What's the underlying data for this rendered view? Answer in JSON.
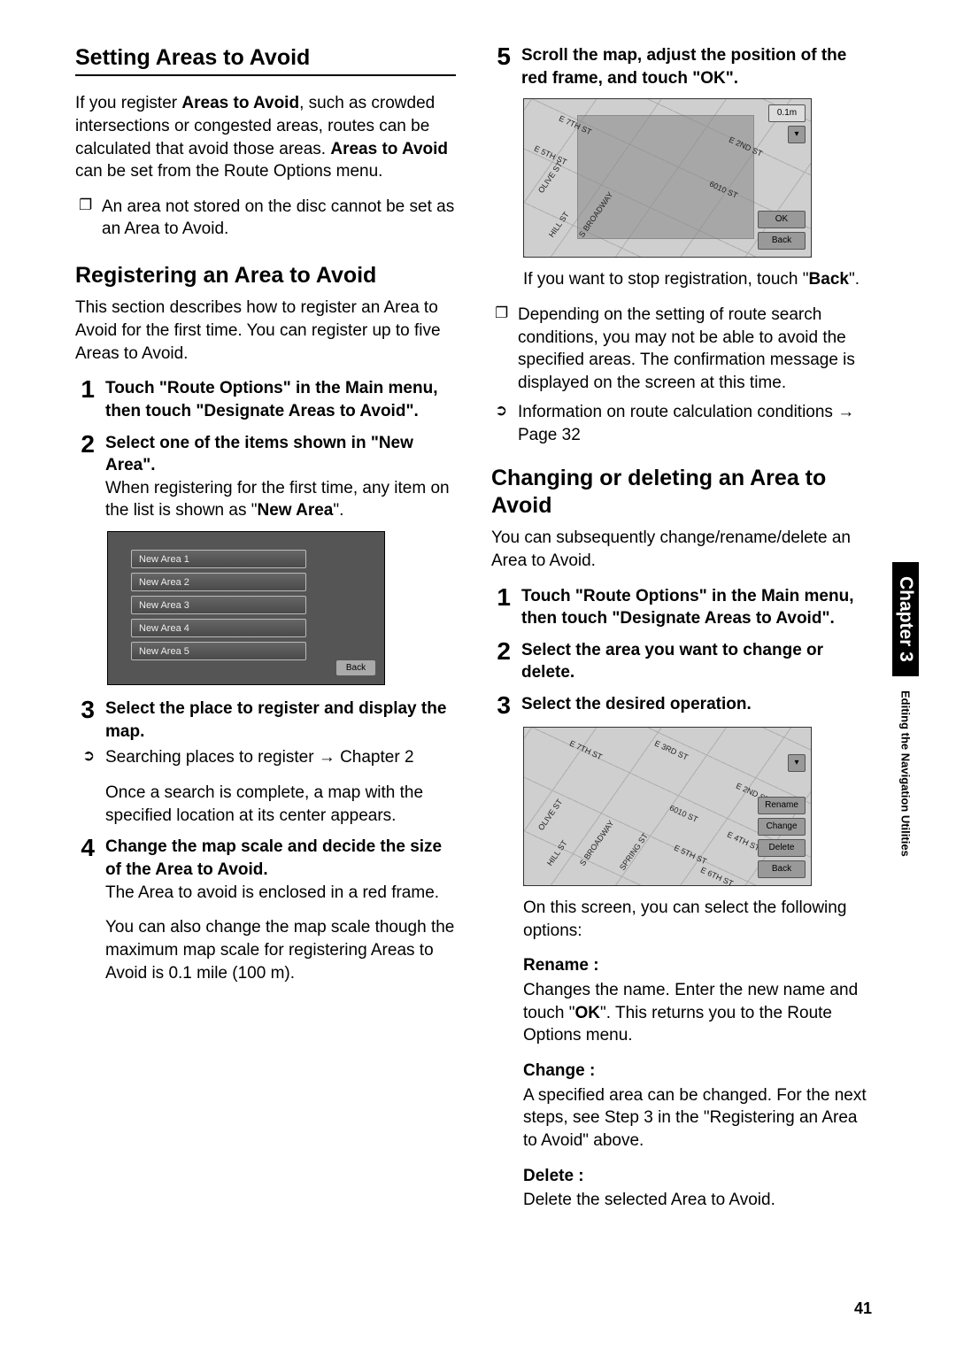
{
  "page_number": "41",
  "side_tab": {
    "chapter": "Chapter 3",
    "subtitle": "Editing the Navigation Utilities"
  },
  "left": {
    "h_setting": "Setting Areas to Avoid",
    "p_setting_1a": "If you register ",
    "p_setting_1b": "Areas to Avoid",
    "p_setting_1c": ", such as crowded intersections or congested areas, routes can be calculated that avoid those areas. ",
    "p_setting_1d": "Areas to Avoid",
    "p_setting_1e": " can be set from the Route Options menu.",
    "note1": "An area not stored on the disc cannot be set as an Area to Avoid.",
    "h_register": "Registering an Area to Avoid",
    "p_register": "This section describes how to register an Area to Avoid for the first time. You can register up to five Areas to Avoid.",
    "step1_title": "Touch \"Route Options\" in the Main menu, then touch \"Designate Areas to Avoid\".",
    "step2_title": "Select one of the items shown in \"New Area\".",
    "step2_body_a": "When registering for the first time, any item on the list is shown as \"",
    "step2_body_b": "New Area",
    "step2_body_c": "\".",
    "ss_items": [
      "New Area 1",
      "New Area 2",
      "New Area 3",
      "New Area 4",
      "New Area 5"
    ],
    "ss_back": "Back",
    "step3_title": "Select the place to register and display the map.",
    "step3_xref_a": "Searching places to register ",
    "step3_xref_b": " Chapter 2",
    "step3_body": "Once a search is complete, a map with the specified location at its center appears.",
    "step4_title": "Change the map scale and decide the size of the Area to Avoid.",
    "step4_body1": "The Area to avoid is enclosed in a red frame.",
    "step4_body2": "You can also change the map scale though the maximum map scale for registering Areas to Avoid is 0.1 mile (100 m)."
  },
  "right": {
    "step5_title": "Scroll the map, adjust the position of the red frame, and touch \"OK\".",
    "map1_scale": "0.1m",
    "map1_ok": "OK",
    "map1_back": "Back",
    "map1_streets": [
      "E 7TH ST",
      "E 5TH ST",
      "E 2ND ST",
      "OLIVE ST",
      "HILL ST",
      "S BROADWAY",
      "6010 ST"
    ],
    "step5_body_a": "If you want to stop registration, touch \"",
    "step5_body_b": "Back",
    "step5_body_c": "\".",
    "note5": "Depending on the setting of route search conditions, you may not be able to avoid the specified areas. The confirmation message is displayed on the screen at this time.",
    "xref5_a": "Information on route calculation conditions ",
    "xref5_b": " Page 32",
    "h_change": "Changing or deleting an Area to Avoid",
    "p_change": "You can subsequently change/rename/delete an Area to Avoid.",
    "cstep1": "Touch \"Route Options\" in the Main menu, then touch \"Designate Areas to Avoid\".",
    "cstep2": "Select the area you want to change or delete.",
    "cstep3": "Select the desired operation.",
    "map2_btns": [
      "Rename",
      "Change",
      "Delete",
      "Back"
    ],
    "map2_streets": [
      "E 7TH ST",
      "E 3RD ST",
      "E 2ND ST",
      "E 5TH ST",
      "E 6TH ST",
      "E 4TH ST",
      "OLIVE ST",
      "HILL ST",
      "S BROADWAY",
      "SPRING ST",
      "6010 ST"
    ],
    "p_options": "On this screen, you can select the following options:",
    "rename_label": "Rename :",
    "rename_body_a": "Changes the name. Enter the new name and touch \"",
    "rename_body_b": "OK",
    "rename_body_c": "\". This returns you to the Route Options menu.",
    "change_label": "Change :",
    "change_body": "A specified area can be changed. For the next steps, see Step 3 in the \"Registering an Area to Avoid\" above.",
    "delete_label": "Delete :",
    "delete_body": "Delete the selected Area to Avoid."
  }
}
